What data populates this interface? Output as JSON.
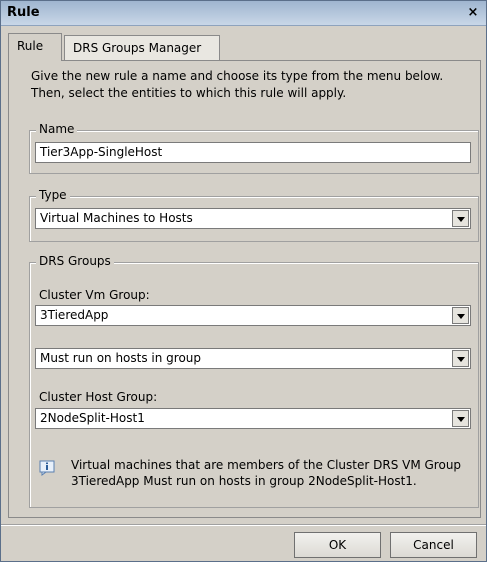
{
  "window": {
    "title": "Rule",
    "close_label": "×"
  },
  "tabs": [
    {
      "label": "Rule",
      "selected": true
    },
    {
      "label": "DRS Groups Manager",
      "selected": false
    }
  ],
  "intro": {
    "line1": "Give the new rule a name and choose its type from the menu below.",
    "line2": "Then, select the entities to which this rule will apply."
  },
  "name_group": {
    "legend": "Name",
    "value": "Tier3App-SingleHost"
  },
  "type_group": {
    "legend": "Type",
    "selected": "Virtual Machines to Hosts"
  },
  "drs_group": {
    "legend": "DRS Groups",
    "vm_group_label": "Cluster Vm Group:",
    "vm_group_value": "3TieredApp",
    "relation_value": "Must run on hosts in group",
    "host_group_label": "Cluster Host Group:",
    "host_group_value": "2NodeSplit-Host1",
    "info_line1": "Virtual machines that are members of the Cluster DRS VM Group",
    "info_line2": "3TieredApp Must run on hosts in group 2NodeSplit-Host1."
  },
  "buttons": {
    "ok": "OK",
    "cancel": "Cancel"
  }
}
